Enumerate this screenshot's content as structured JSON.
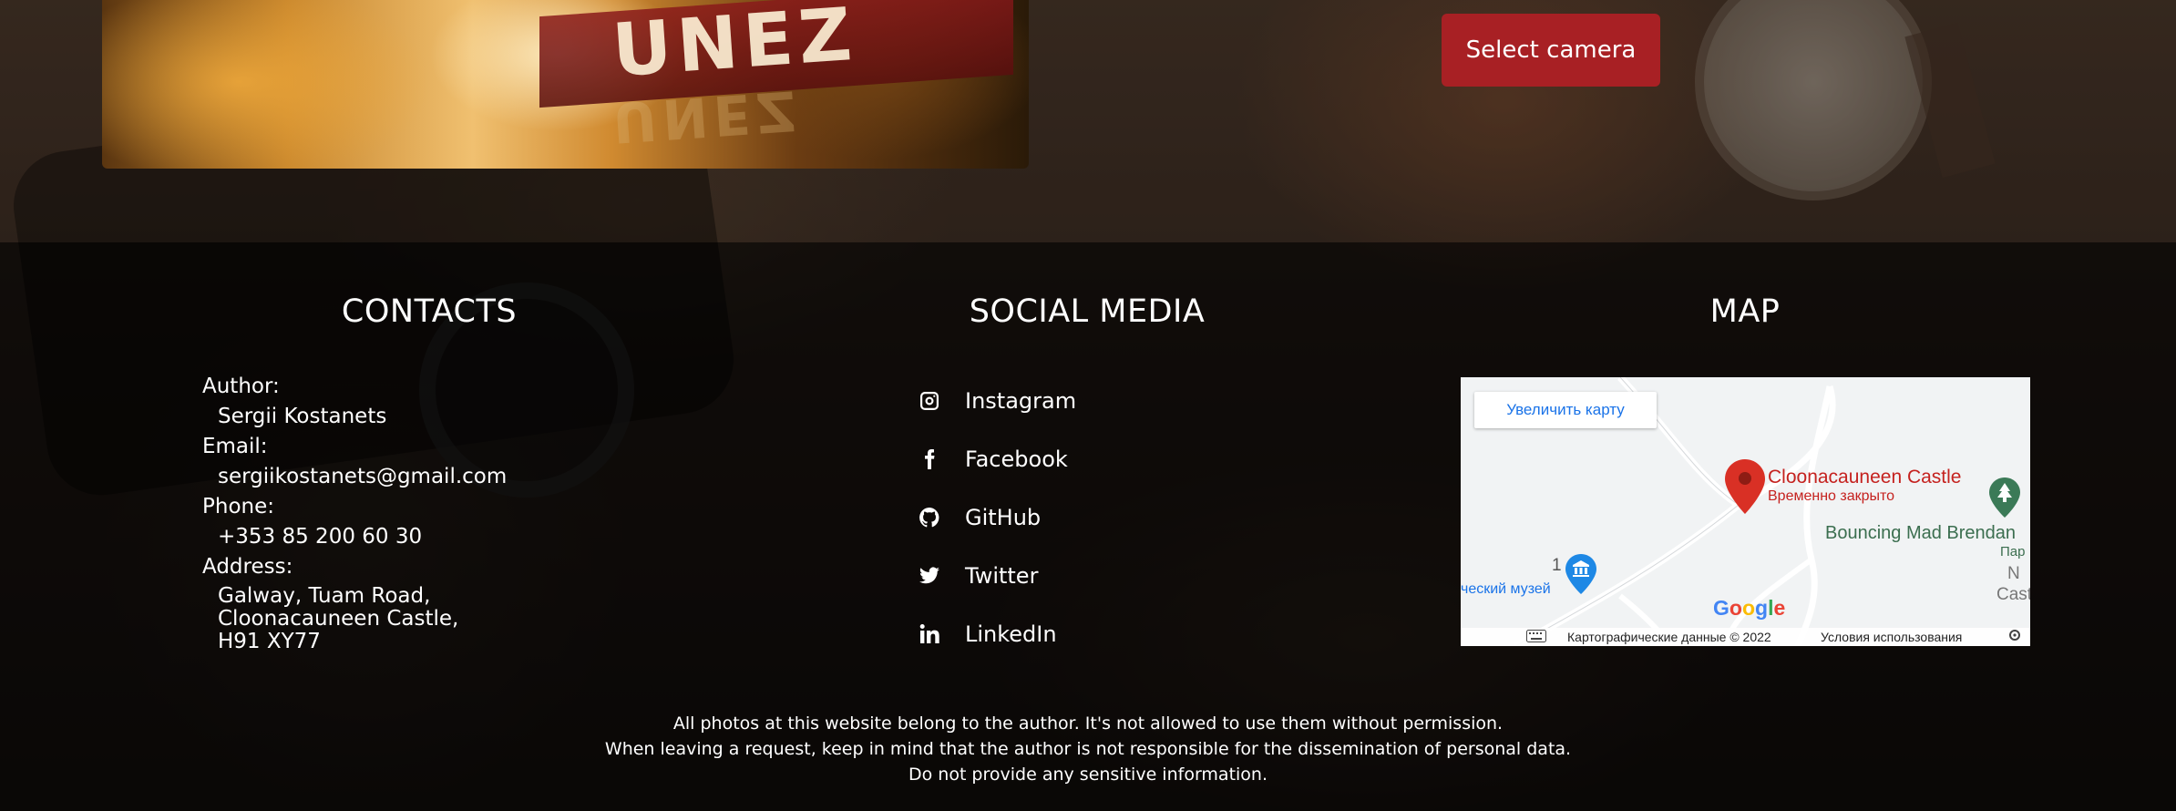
{
  "hero": {
    "photo_text": "UNEZ",
    "select_button": "Select camera"
  },
  "contacts": {
    "title": "CONTACTS",
    "author_label": "Author:",
    "author": "Sergii Kostanets",
    "email_label": "Email:",
    "email": "sergiikostanets@gmail.com",
    "phone_label": "Phone:",
    "phone": "+353 85 200 60 30",
    "address_label": "Address:",
    "address_lines": [
      "Galway, Tuam Road,",
      "Cloonacauneen Castle,",
      "H91 XY77"
    ]
  },
  "social": {
    "title": "SOCIAL MEDIA",
    "items": [
      {
        "label": "Instagram",
        "icon": "instagram-icon"
      },
      {
        "label": "Facebook",
        "icon": "facebook-icon"
      },
      {
        "label": "GitHub",
        "icon": "github-icon"
      },
      {
        "label": "Twitter",
        "icon": "twitter-icon"
      },
      {
        "label": "LinkedIn",
        "icon": "linkedin-icon"
      }
    ]
  },
  "map": {
    "title": "MAP",
    "enlarge": "Увеличить карту",
    "place_name": "Cloonacauneen Castle",
    "place_status": "Временно закрыто",
    "poi_bouncing": "Bouncing Mad Brendan",
    "poi_park": "Пар",
    "poi_n": "N",
    "poi_cast": "Cast",
    "museum_num": "1",
    "museum": "ческий музей",
    "logo": "Google",
    "map_data": "Картографические данные © 2022",
    "terms": "Условия использования"
  },
  "footer": {
    "lines": [
      "All photos at this website belong to the author. It's not allowed to use them without permission.",
      "When leaving a request, keep in mind that the author is not responsible for the dissemination of personal data.",
      "Do not provide any sensitive information."
    ]
  },
  "colors": {
    "accent_button": "#a82024",
    "map_pin": "#d93025",
    "map_link": "#1a73e8"
  }
}
